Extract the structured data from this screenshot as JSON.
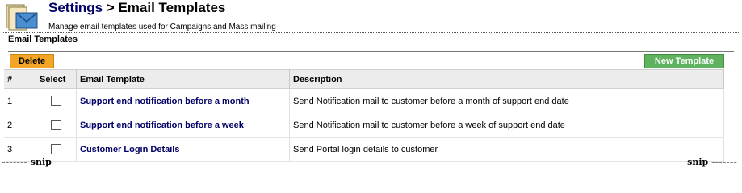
{
  "header": {
    "breadcrumb": "Settings",
    "separator": ">",
    "page": "Email Templates",
    "description": "Manage email templates used for Campaigns and Mass mailing"
  },
  "section": {
    "title": "Email Templates"
  },
  "toolbar": {
    "delete_label": "Delete",
    "new_label": "New Template"
  },
  "table": {
    "columns": [
      "#",
      "Select",
      "Email Template",
      "Description"
    ],
    "rows": [
      {
        "num": "1",
        "name": "Support end notification before a month",
        "description": "Send Notification mail to customer before a month of support end date"
      },
      {
        "num": "2",
        "name": "Support end notification before a week",
        "description": "Send Notification mail to customer before a week of support end date"
      },
      {
        "num": "3",
        "name": "Customer Login Details",
        "description": "Send Portal login details to customer"
      }
    ]
  },
  "snip": {
    "left": "------- snip",
    "right": "snip -------"
  },
  "icon": "email-templates-icon",
  "colors": {
    "crumb": "#000066",
    "delete": "#f3a626",
    "new": "#5fb35f"
  }
}
